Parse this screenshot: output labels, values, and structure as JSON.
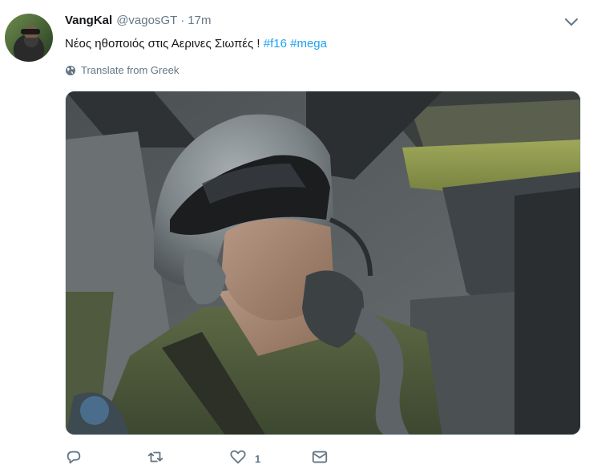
{
  "tweet": {
    "author": {
      "display_name": "VangKal",
      "handle": "@vagosGT",
      "avatar_icon": "avatar-photo"
    },
    "separator": "·",
    "timestamp": "17m",
    "text_prefix": "Νέος ηθοποιός στις Αερινες Σιωπές ! ",
    "hashtags": [
      "#f16",
      "#mega"
    ],
    "translate_label": "Translate from Greek",
    "menu_icon": "chevron-down-icon",
    "media": {
      "kind": "photo",
      "subject": "pilot-in-cockpit-photo"
    },
    "actions": {
      "reply_icon": "reply-icon",
      "retweet_icon": "retweet-icon",
      "like_icon": "heart-icon",
      "like_count": "1",
      "dm_icon": "envelope-icon"
    },
    "colors": {
      "link": "#1da1f2",
      "secondary_text": "#657786",
      "primary_text": "#14171a"
    }
  }
}
